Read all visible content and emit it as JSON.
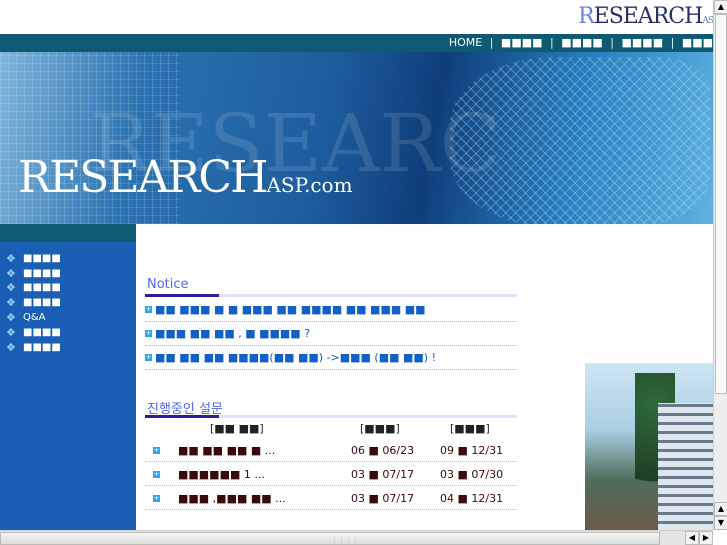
{
  "header": {
    "logo_first": "R",
    "logo_rest": "ESEARCH",
    "logo_suffix": "AS"
  },
  "nav": {
    "items": [
      "HOME",
      "■■■■",
      "■■■■",
      "■■■■",
      "■■■"
    ],
    "separator": "|"
  },
  "banner": {
    "watermark": "RESEARC",
    "title": "RESEARCH",
    "title_suffix": "ASP.com"
  },
  "sidebar": {
    "items": [
      "■■■■",
      "■■■■",
      "■■■■",
      "■■■■",
      "Q&A",
      "■■■■",
      "■■■■"
    ]
  },
  "notice": {
    "title": "Notice",
    "items": [
      "■■ ■■■ ■ ■ ■■■ ■■ ■■■■ ■■ ■■■ ■■",
      "■■■ ■■ ■■ , ■ ■■■■ ?",
      "■■ ■■ ■■ ■■■■(■■ ■■) ->■■■ (■■ ■■) !"
    ]
  },
  "survey": {
    "title": "진행중인 설문",
    "headers": [
      "[■■ ■■]",
      "[■■■]",
      "[■■■]"
    ],
    "rows": [
      {
        "title": "■■ ■■ ■■ ■ ...",
        "start": "06 ■ 06/23",
        "end": "09 ■ 12/31"
      },
      {
        "title": "■■■■■■ 1 ...",
        "start": "03 ■ 07/17",
        "end": "03 ■ 07/30"
      },
      {
        "title": "■■■ ,■■■ ■■ ...",
        "start": "03 ■ 07/17",
        "end": "04 ■ 12/31"
      }
    ]
  }
}
